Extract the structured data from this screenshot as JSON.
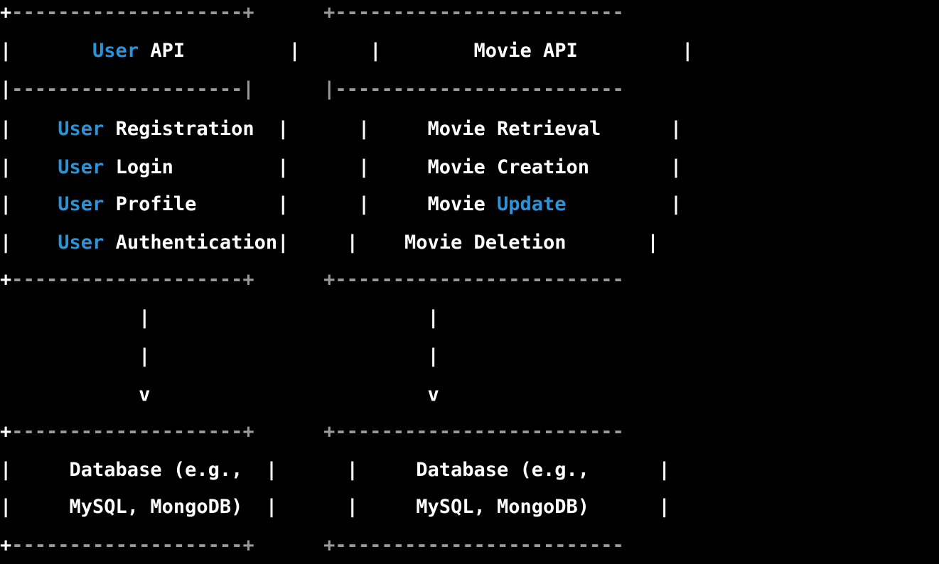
{
  "colors": {
    "background": "#000000",
    "text": "#ffffff",
    "keyword": "#2b93d8",
    "border": "#9a9a9a"
  },
  "lines": [
    [
      {
        "t": "+",
        "c": "txt"
      },
      {
        "t": "--------------------+      +-------------------------",
        "c": "dim"
      }
    ],
    [
      {
        "t": "|       ",
        "c": "txt"
      },
      {
        "t": "User",
        "c": "kw"
      },
      {
        "t": " API         |      |        Movie API         |",
        "c": "txt"
      }
    ],
    [
      {
        "t": "|",
        "c": "txt"
      },
      {
        "t": "--------------------|      |-------------------------",
        "c": "dim"
      }
    ],
    [
      {
        "t": "|    ",
        "c": "txt"
      },
      {
        "t": "User",
        "c": "kw"
      },
      {
        "t": " Registration  |      |     Movie Retrieval      |",
        "c": "txt"
      }
    ],
    [
      {
        "t": "|    ",
        "c": "txt"
      },
      {
        "t": "User",
        "c": "kw"
      },
      {
        "t": " Login         |      |     Movie Creation       |",
        "c": "txt"
      }
    ],
    [
      {
        "t": "|    ",
        "c": "txt"
      },
      {
        "t": "User",
        "c": "kw"
      },
      {
        "t": " Profile       |      |     Movie ",
        "c": "txt"
      },
      {
        "t": "Update",
        "c": "kw"
      },
      {
        "t": "         |",
        "c": "txt"
      }
    ],
    [
      {
        "t": "|    ",
        "c": "txt"
      },
      {
        "t": "User",
        "c": "kw"
      },
      {
        "t": " Authentication|     |    Movie Deletion       |",
        "c": "txt"
      }
    ],
    [
      {
        "t": "+",
        "c": "txt"
      },
      {
        "t": "--------------------+      +-------------------------",
        "c": "dim"
      }
    ],
    [
      {
        "t": "            |                        |",
        "c": "txt"
      }
    ],
    [
      {
        "t": "            |                        |",
        "c": "txt"
      }
    ],
    [
      {
        "t": "            v                        v",
        "c": "txt"
      }
    ],
    [
      {
        "t": "+",
        "c": "txt"
      },
      {
        "t": "--------------------+      +-------------------------",
        "c": "dim"
      }
    ],
    [
      {
        "t": "|     Database (e.g.,  |      |     Database (e.g.,      |",
        "c": "txt"
      }
    ],
    [
      {
        "t": "|     MySQL, MongoDB)  |      |     MySQL, MongoDB)      |",
        "c": "txt"
      }
    ],
    [
      {
        "t": "+",
        "c": "txt"
      },
      {
        "t": "--------------------+      +-------------------------",
        "c": "dim"
      }
    ]
  ]
}
